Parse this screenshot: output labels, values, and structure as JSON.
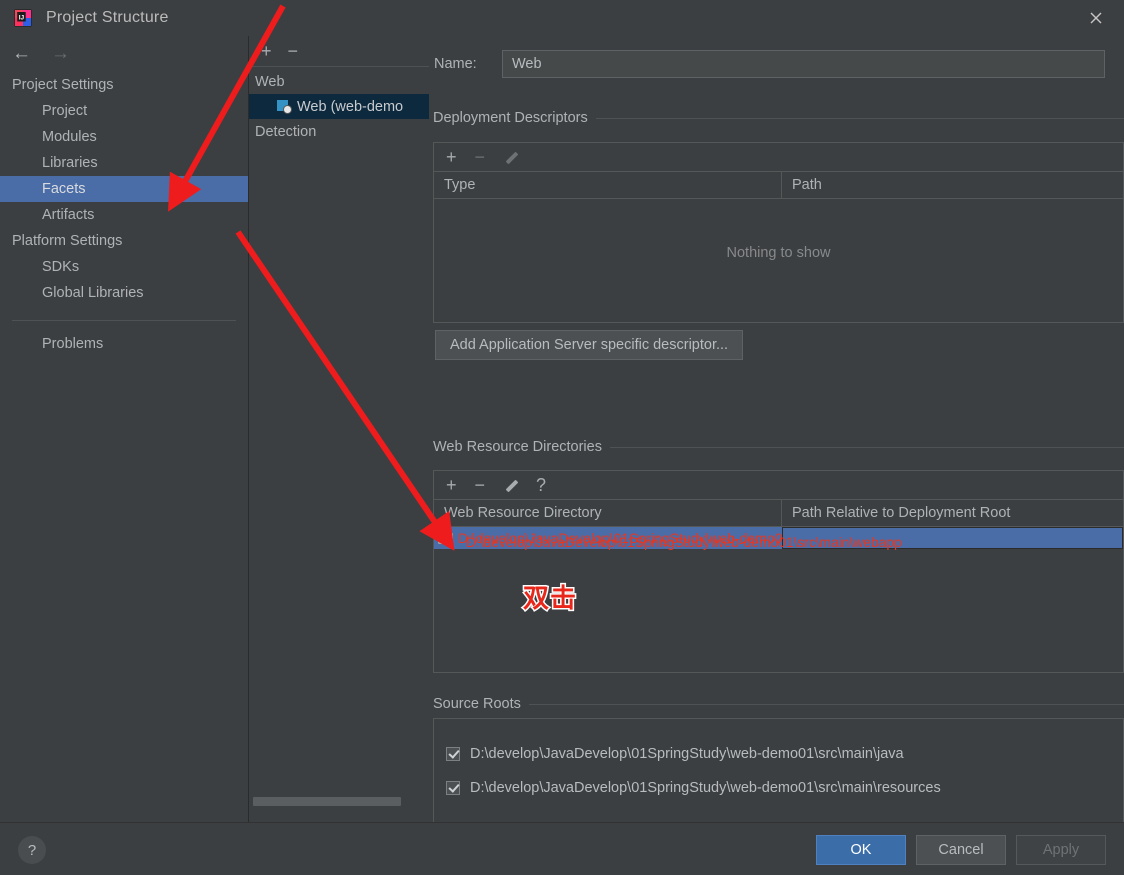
{
  "window": {
    "title": "Project Structure",
    "app_icon": "intellij-idea-icon",
    "close_icon": "close-icon"
  },
  "sidebar": {
    "nav": {
      "back_icon": "arrow-left-icon",
      "forward_icon": "arrow-right-icon"
    },
    "groups": [
      {
        "label": "Project Settings",
        "items": [
          {
            "label": "Project",
            "selected": false
          },
          {
            "label": "Modules",
            "selected": false
          },
          {
            "label": "Libraries",
            "selected": false
          },
          {
            "label": "Facets",
            "selected": true
          },
          {
            "label": "Artifacts",
            "selected": false
          }
        ]
      },
      {
        "label": "Platform Settings",
        "items": [
          {
            "label": "SDKs",
            "selected": false
          },
          {
            "label": "Global Libraries",
            "selected": false
          }
        ]
      }
    ],
    "problems_label": "Problems"
  },
  "facet_tree": {
    "toolbar": {
      "add_icon": "plus-icon",
      "remove_icon": "minus-icon"
    },
    "rows": [
      {
        "label": "Web",
        "type": "group",
        "selected": false
      },
      {
        "label": "Web (web-demo",
        "type": "facet",
        "selected": true,
        "icon": "web-facet-icon"
      },
      {
        "label": "Detection",
        "type": "group",
        "selected": false
      }
    ]
  },
  "main": {
    "name_label": "Name:",
    "name_value": "Web",
    "deployment_descriptors": {
      "title": "Deployment Descriptors",
      "toolbar": [
        {
          "icon": "plus-icon",
          "enabled": true
        },
        {
          "icon": "minus-icon",
          "enabled": false
        },
        {
          "icon": "pencil-icon",
          "enabled": false
        }
      ],
      "columns": [
        "Type",
        "Path"
      ],
      "empty_message": "Nothing to show",
      "add_descriptor_button": "Add Application Server specific descriptor..."
    },
    "web_resource_directories": {
      "title": "Web Resource Directories",
      "toolbar": [
        {
          "icon": "plus-icon",
          "enabled": true
        },
        {
          "icon": "minus-icon",
          "enabled": true
        },
        {
          "icon": "pencil-icon",
          "enabled": true
        },
        {
          "icon": "question-icon",
          "enabled": true
        }
      ],
      "columns": [
        "Web Resource Directory",
        "Path Relative to Deployment Root"
      ],
      "rows": [
        {
          "directory": "D:\\develop\\JavaDevelop\\01SpringStudy\\web-demo01\\src\\main\\webapp",
          "relative_path": "",
          "selected": true,
          "icon": "folder-icon"
        }
      ]
    },
    "source_roots": {
      "title": "Source Roots",
      "items": [
        {
          "label": "D:\\develop\\JavaDevelop\\01SpringStudy\\web-demo01\\src\\main\\java",
          "checked": true
        },
        {
          "label": "D:\\develop\\JavaDevelop\\01SpringStudy\\web-demo01\\src\\main\\resources",
          "checked": true
        }
      ]
    }
  },
  "annotations": {
    "double_click_text": "双击",
    "arrow_color": "#ee1c1c",
    "arrow_count": 2
  },
  "footer": {
    "help_icon": "question-mark-icon",
    "buttons": [
      {
        "label": "OK",
        "style": "primary",
        "enabled": true
      },
      {
        "label": "Cancel",
        "style": "default",
        "enabled": true
      },
      {
        "label": "Apply",
        "style": "default",
        "enabled": false
      }
    ]
  },
  "colors": {
    "background": "#3c3f41",
    "selection_blue": "#4a6da7",
    "tree_selection": "#0d293e",
    "primary_button": "#3b6ea8",
    "annotation_red": "#e8361f"
  }
}
